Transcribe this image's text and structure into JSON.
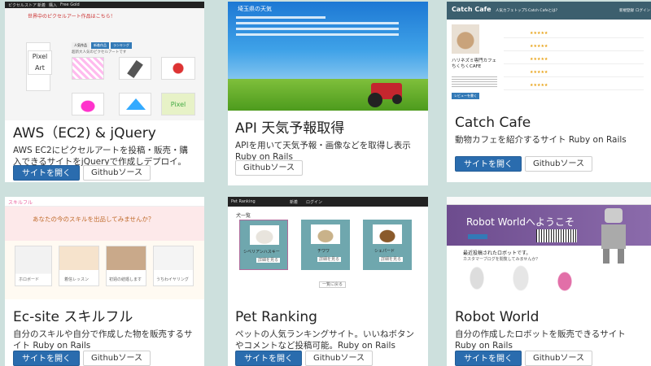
{
  "colors": {
    "background": "#cde0dd",
    "primary": "#2a6cae"
  },
  "cards": [
    {
      "title": "AWS（EC2) & jQuery",
      "desc": "AWS EC2にピクセルアートを投稿・販売・購入できるサイトをjQueryで作成しデプロイ。",
      "open": "サイトを開く",
      "github": "Githubソース",
      "thumb": {
        "nav_brand": "ピクセルストア",
        "nav_items": [
          "新着",
          "購入",
          "Free Gold"
        ],
        "heading": "世界中のピクセルアート作品はこちら！",
        "sub": "超新大人気のピクセルアートです",
        "tabs": [
          "人気作品",
          "新着作品",
          "ランキング"
        ],
        "logo_text": "Pixel Art"
      }
    },
    {
      "title": "API 天気予報取得",
      "desc": "APIを用いて天気予報・画像などを取得し表示 Ruby on Rails",
      "open": "",
      "github": "Githubソース",
      "thumb": {
        "heading": "埼玉県の天気"
      }
    },
    {
      "title": "Catch Cafe",
      "desc": "動物カフェを紹介するサイト Ruby on Rails",
      "open": "サイトを開く",
      "github": "Githubソース",
      "thumb": {
        "brand": "Catch Cafe",
        "nav_items": [
          "人気カフェトップ5",
          "Catch Cafeとは?"
        ],
        "nav_right": [
          "新規登録",
          "ログイン"
        ],
        "cafe_name": "ハリネズミ専門カフェ ちくちくCAFE",
        "review_button": "レビューを書く"
      }
    },
    {
      "title": "Ec-site スキルフル",
      "desc": "自分のスキルや自分で作成した物を販売するサイト Ruby on Rails",
      "open": "サイトを開く",
      "github": "Githubソース",
      "thumb": {
        "brand": "スキルフル",
        "heading": "あなたの今のスキルを出品してみませんか？",
        "items": [
          "ホロボード",
          "着信レッスン",
          "初週の結婚します",
          "うちわイヤリング"
        ]
      }
    },
    {
      "title": "Pet Ranking",
      "desc": "ペットの人気ランキングサイト。いいねボタンやコメントなど投稿可能。Ruby on Rails",
      "open": "サイトを開く",
      "github": "Githubソース",
      "thumb": {
        "nav_items": [
          "Pet Ranking",
          "新着",
          "ログイン"
        ],
        "list_title": "犬一覧",
        "pets": [
          "シベリアンハスキー",
          "チワワ",
          "シェパード"
        ],
        "detail_btn": "詳細を見る",
        "more_btn": "一覧に戻る"
      }
    },
    {
      "title": "Robot World",
      "desc": "自分の作成したロボットを販売できるサイト Ruby on Rails",
      "open": "サイトを開く",
      "github": "Githubソース",
      "thumb": {
        "heading": "Robot Worldへようこそ",
        "section": "最近投稿されたロボットです。",
        "sub": "カスタマーブログを閲覧してみませんか？"
      }
    }
  ]
}
